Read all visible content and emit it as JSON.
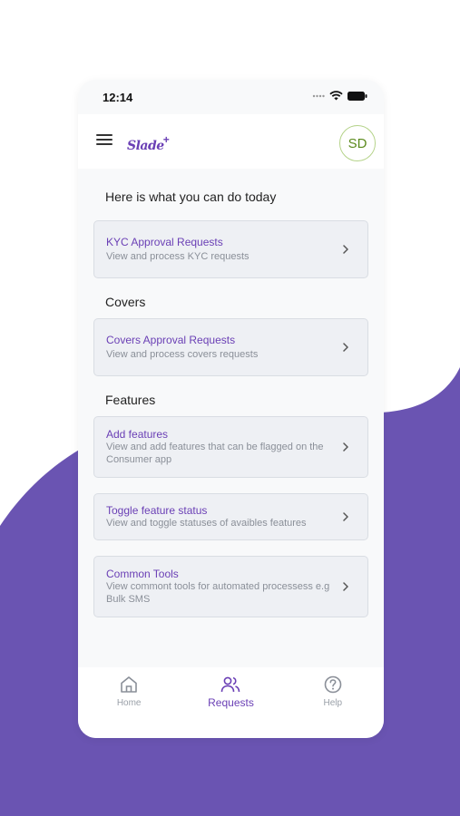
{
  "status_bar": {
    "time": "12:14"
  },
  "app_bar": {
    "logo_text": "Slade",
    "logo_plus": "+",
    "avatar_initials": "SD"
  },
  "intro_title": "Here is what you can do today",
  "kyc_card": {
    "title": "KYC Approval Requests",
    "subtitle": "View and process KYC requests"
  },
  "covers_section": {
    "title": "Covers"
  },
  "covers_card": {
    "title": "Covers Approval Requests",
    "subtitle": "View and process covers requests"
  },
  "features_section": {
    "title": "Features"
  },
  "feature_cards": [
    {
      "title": "Add features",
      "subtitle": "View and add features that can be flagged on the Consumer app"
    },
    {
      "title": "Toggle feature status",
      "subtitle": "View and toggle statuses of avaibles features"
    },
    {
      "title": "Common Tools",
      "subtitle": "View commont tools for automated processess e.g Bulk SMS"
    }
  ],
  "tab_bar": {
    "home": {
      "label": "Home",
      "icon": "home-icon"
    },
    "requests": {
      "label": "Requests",
      "icon": "users-icon"
    },
    "help": {
      "label": "Help",
      "icon": "help-circle-icon"
    }
  },
  "colors": {
    "accent": "#6a3fb5",
    "background_wave": "#6a54b2",
    "avatar_border": "#b5d38a"
  }
}
